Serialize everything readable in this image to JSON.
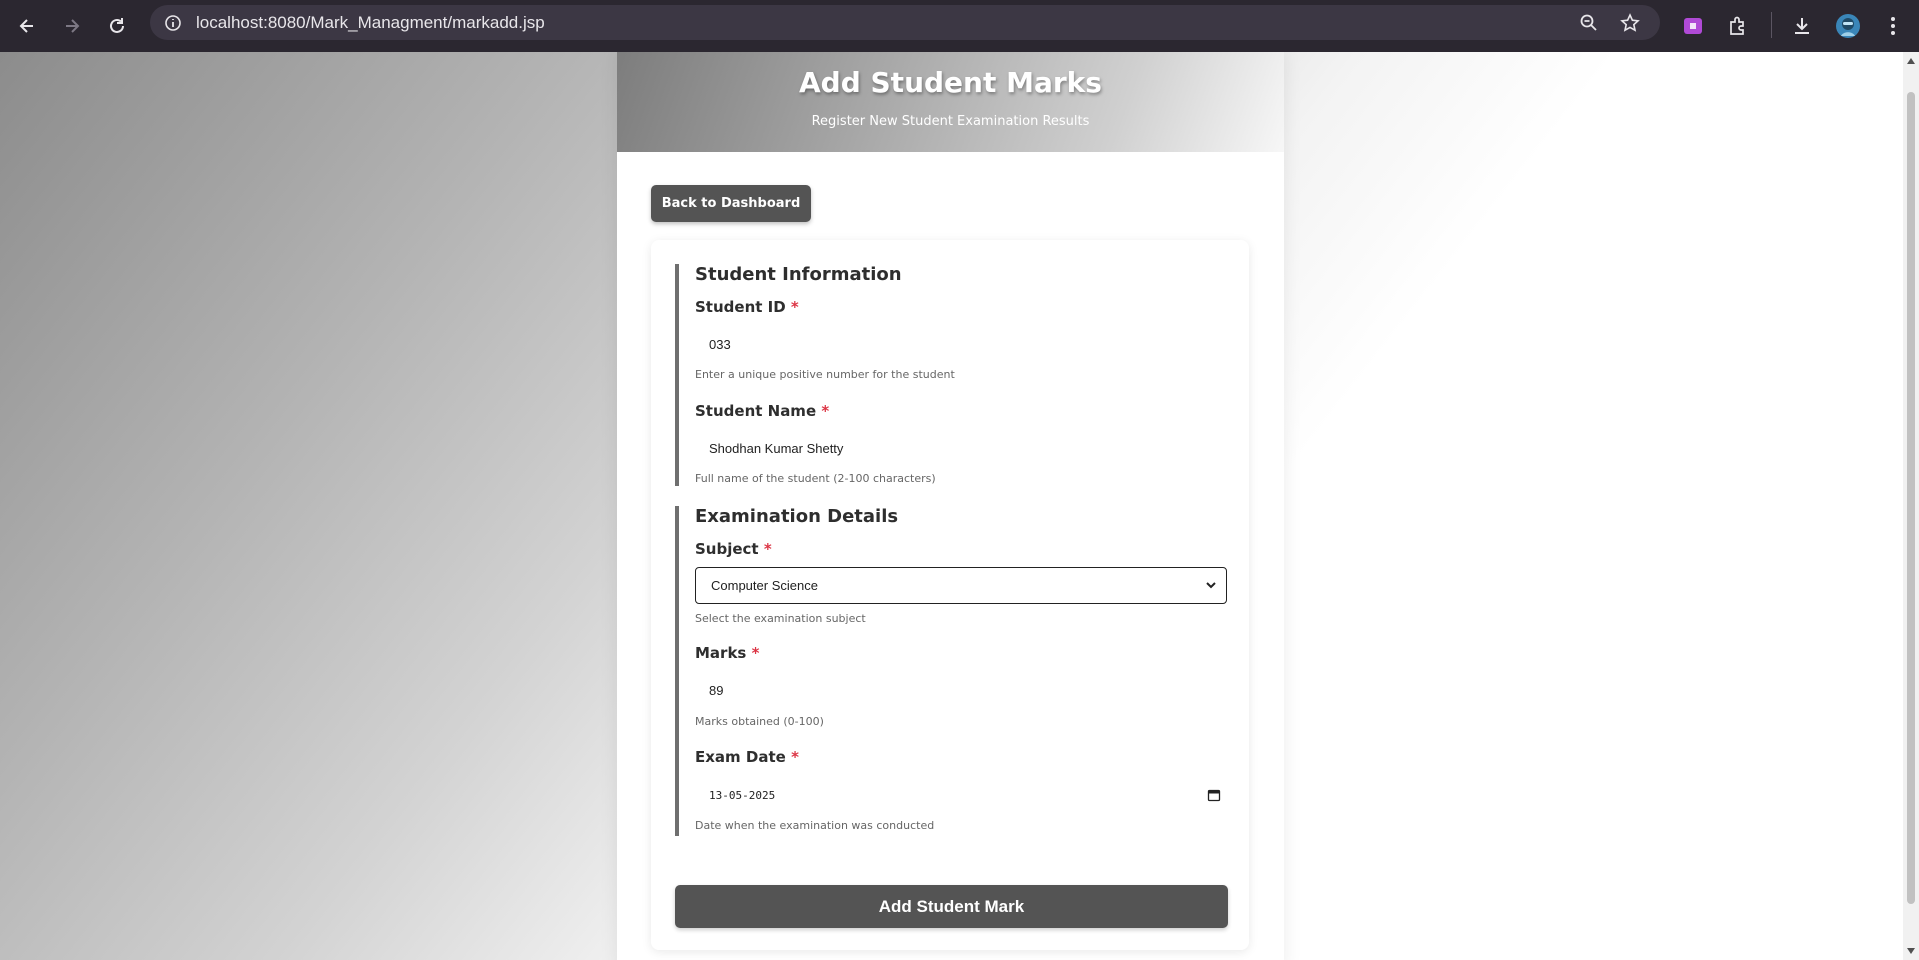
{
  "browser": {
    "url": "localhost:8080/Mark_Managment/markadd.jsp",
    "icons": [
      "back-icon",
      "forward-icon",
      "reload-icon",
      "site-info-icon",
      "zoom-icon",
      "bookmark-star-icon",
      "extension-badge-icon",
      "extensions-puzzle-icon",
      "download-icon",
      "profile-avatar-icon",
      "menu-kebab-icon"
    ]
  },
  "header": {
    "title": "Add Student Marks",
    "subtitle": "Register New Student Examination Results"
  },
  "back_button": {
    "label": "Back to Dashboard"
  },
  "student_section": {
    "title": "Student Information",
    "student_id": {
      "label": "Student ID",
      "required_mark": "*",
      "value": "033",
      "help": "Enter a unique positive number for the student"
    },
    "student_name": {
      "label": "Student Name",
      "required_mark": "*",
      "value": "Shodhan Kumar Shetty",
      "help": "Full name of the student (2-100 characters)"
    }
  },
  "exam_section": {
    "title": "Examination Details",
    "subject": {
      "label": "Subject",
      "required_mark": "*",
      "selected": "Computer Science",
      "help": "Select the examination subject"
    },
    "marks": {
      "label": "Marks",
      "required_mark": "*",
      "value": "89",
      "help": "Marks obtained (0-100)"
    },
    "exam_date": {
      "label": "Exam Date",
      "required_mark": "*",
      "value": "13-05-2025",
      "help": "Date when the examination was conducted"
    }
  },
  "submit_button": {
    "label": "Add Student Mark"
  },
  "colors": {
    "button": "#545454",
    "required": "#dc3545",
    "section_border": "#6f6f6f",
    "chrome_bg": "#2b2730"
  }
}
